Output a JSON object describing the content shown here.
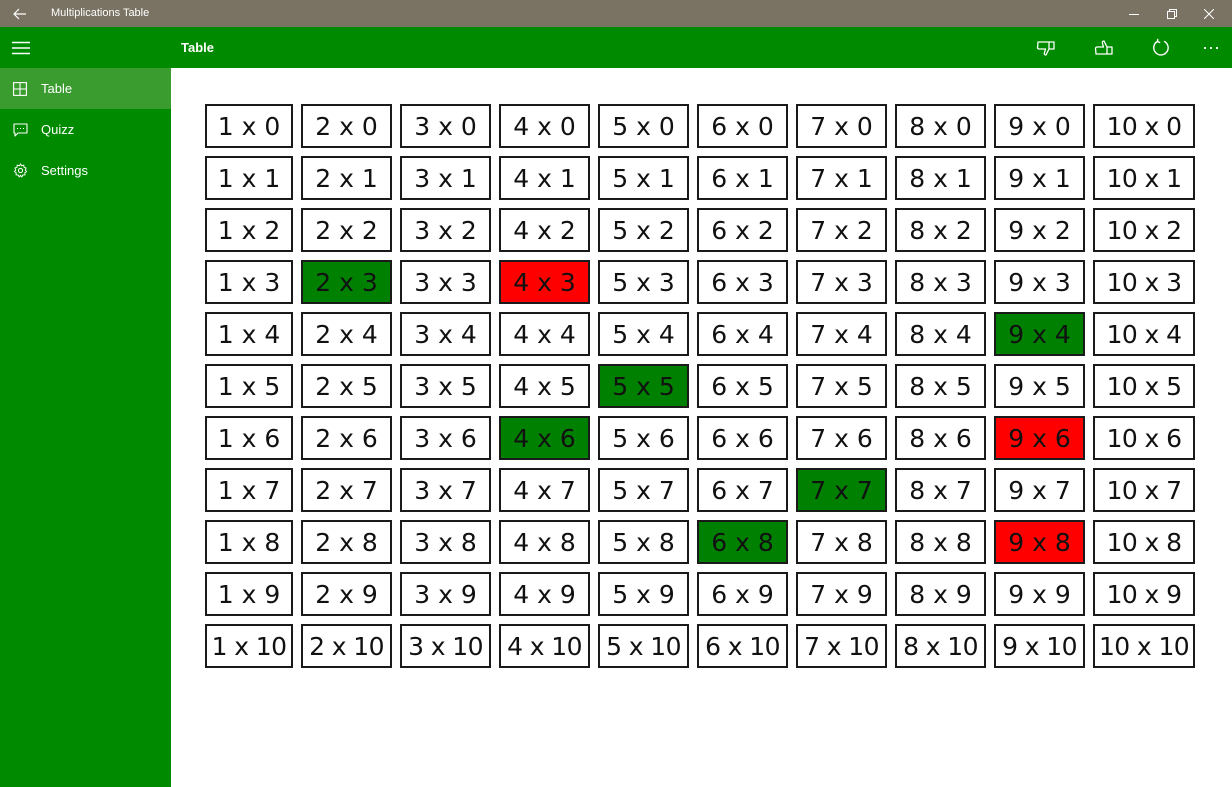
{
  "window": {
    "title": "Multiplications Table",
    "back_icon": "back-arrow-icon",
    "minimize_icon": "minimize-icon",
    "maximize_icon": "restore-icon",
    "close_icon": "close-icon"
  },
  "appbar": {
    "title": "Table",
    "menu_icon": "hamburger-icon",
    "actions": [
      "thumbs-down-icon",
      "thumbs-up-icon",
      "refresh-icon",
      "more-icon"
    ]
  },
  "sidebar": {
    "items": [
      {
        "label": "Table",
        "icon": "table-grid-icon",
        "selected": true
      },
      {
        "label": "Quizz",
        "icon": "chat-bubble-icon",
        "selected": false
      },
      {
        "label": "Settings",
        "icon": "gear-icon",
        "selected": false
      }
    ]
  },
  "colors": {
    "titlebar": "#7a7363",
    "accent": "#008a00",
    "selected_nav": "#3a9c2f",
    "correct": "#008000",
    "wrong": "#ff0000"
  },
  "table": {
    "rows": [
      [
        {
          "t": "1 x 0",
          "s": ""
        },
        {
          "t": "2 x 0",
          "s": ""
        },
        {
          "t": "3 x 0",
          "s": ""
        },
        {
          "t": "4 x 0",
          "s": ""
        },
        {
          "t": "5 x 0",
          "s": ""
        },
        {
          "t": "6 x 0",
          "s": ""
        },
        {
          "t": "7 x 0",
          "s": ""
        },
        {
          "t": "8 x 0",
          "s": ""
        },
        {
          "t": "9 x 0",
          "s": ""
        },
        {
          "t": "10 x 0",
          "s": ""
        }
      ],
      [
        {
          "t": "1 x 1",
          "s": ""
        },
        {
          "t": "2 x 1",
          "s": ""
        },
        {
          "t": "3 x 1",
          "s": ""
        },
        {
          "t": "4 x 1",
          "s": ""
        },
        {
          "t": "5 x 1",
          "s": ""
        },
        {
          "t": "6 x 1",
          "s": ""
        },
        {
          "t": "7 x 1",
          "s": ""
        },
        {
          "t": "8 x 1",
          "s": ""
        },
        {
          "t": "9 x 1",
          "s": ""
        },
        {
          "t": "10 x 1",
          "s": ""
        }
      ],
      [
        {
          "t": "1 x 2",
          "s": ""
        },
        {
          "t": "2 x 2",
          "s": ""
        },
        {
          "t": "3 x 2",
          "s": ""
        },
        {
          "t": "4 x 2",
          "s": ""
        },
        {
          "t": "5 x 2",
          "s": ""
        },
        {
          "t": "6 x 2",
          "s": ""
        },
        {
          "t": "7 x 2",
          "s": ""
        },
        {
          "t": "8 x 2",
          "s": ""
        },
        {
          "t": "9 x 2",
          "s": ""
        },
        {
          "t": "10 x 2",
          "s": ""
        }
      ],
      [
        {
          "t": "1 x 3",
          "s": ""
        },
        {
          "t": "2 x 3",
          "s": "green"
        },
        {
          "t": "3 x 3",
          "s": ""
        },
        {
          "t": "4 x 3",
          "s": "red"
        },
        {
          "t": "5 x 3",
          "s": ""
        },
        {
          "t": "6 x 3",
          "s": ""
        },
        {
          "t": "7 x 3",
          "s": ""
        },
        {
          "t": "8 x 3",
          "s": ""
        },
        {
          "t": "9 x 3",
          "s": ""
        },
        {
          "t": "10 x 3",
          "s": ""
        }
      ],
      [
        {
          "t": "1 x 4",
          "s": ""
        },
        {
          "t": "2 x 4",
          "s": ""
        },
        {
          "t": "3 x 4",
          "s": ""
        },
        {
          "t": "4 x 4",
          "s": ""
        },
        {
          "t": "5 x 4",
          "s": ""
        },
        {
          "t": "6 x 4",
          "s": ""
        },
        {
          "t": "7 x 4",
          "s": ""
        },
        {
          "t": "8 x 4",
          "s": ""
        },
        {
          "t": "9 x 4",
          "s": "green"
        },
        {
          "t": "10 x 4",
          "s": ""
        }
      ],
      [
        {
          "t": "1 x 5",
          "s": ""
        },
        {
          "t": "2 x 5",
          "s": ""
        },
        {
          "t": "3 x 5",
          "s": ""
        },
        {
          "t": "4 x 5",
          "s": ""
        },
        {
          "t": "5 x 5",
          "s": "green"
        },
        {
          "t": "6 x 5",
          "s": ""
        },
        {
          "t": "7 x 5",
          "s": ""
        },
        {
          "t": "8 x 5",
          "s": ""
        },
        {
          "t": "9 x 5",
          "s": ""
        },
        {
          "t": "10 x 5",
          "s": ""
        }
      ],
      [
        {
          "t": "1 x 6",
          "s": ""
        },
        {
          "t": "2 x 6",
          "s": ""
        },
        {
          "t": "3 x 6",
          "s": ""
        },
        {
          "t": "4 x 6",
          "s": "green"
        },
        {
          "t": "5 x 6",
          "s": ""
        },
        {
          "t": "6 x 6",
          "s": ""
        },
        {
          "t": "7 x 6",
          "s": ""
        },
        {
          "t": "8 x 6",
          "s": ""
        },
        {
          "t": "9 x 6",
          "s": "red"
        },
        {
          "t": "10 x 6",
          "s": ""
        }
      ],
      [
        {
          "t": "1 x 7",
          "s": ""
        },
        {
          "t": "2 x 7",
          "s": ""
        },
        {
          "t": "3 x 7",
          "s": ""
        },
        {
          "t": "4 x 7",
          "s": ""
        },
        {
          "t": "5 x 7",
          "s": ""
        },
        {
          "t": "6 x 7",
          "s": ""
        },
        {
          "t": "7 x 7",
          "s": "green"
        },
        {
          "t": "8 x 7",
          "s": ""
        },
        {
          "t": "9 x 7",
          "s": ""
        },
        {
          "t": "10 x 7",
          "s": ""
        }
      ],
      [
        {
          "t": "1 x 8",
          "s": ""
        },
        {
          "t": "2 x 8",
          "s": ""
        },
        {
          "t": "3 x 8",
          "s": ""
        },
        {
          "t": "4 x 8",
          "s": ""
        },
        {
          "t": "5 x 8",
          "s": ""
        },
        {
          "t": "6 x 8",
          "s": "green"
        },
        {
          "t": "7 x 8",
          "s": ""
        },
        {
          "t": "8 x 8",
          "s": ""
        },
        {
          "t": "9 x 8",
          "s": "red"
        },
        {
          "t": "10 x 8",
          "s": ""
        }
      ],
      [
        {
          "t": "1 x 9",
          "s": ""
        },
        {
          "t": "2 x 9",
          "s": ""
        },
        {
          "t": "3 x 9",
          "s": ""
        },
        {
          "t": "4 x 9",
          "s": ""
        },
        {
          "t": "5 x 9",
          "s": ""
        },
        {
          "t": "6 x 9",
          "s": ""
        },
        {
          "t": "7 x 9",
          "s": ""
        },
        {
          "t": "8 x 9",
          "s": ""
        },
        {
          "t": "9 x 9",
          "s": ""
        },
        {
          "t": "10 x 9",
          "s": ""
        }
      ],
      [
        {
          "t": "1 x 10",
          "s": ""
        },
        {
          "t": "2 x 10",
          "s": ""
        },
        {
          "t": "3 x 10",
          "s": ""
        },
        {
          "t": "4 x 10",
          "s": ""
        },
        {
          "t": "5 x 10",
          "s": ""
        },
        {
          "t": "6 x 10",
          "s": ""
        },
        {
          "t": "7 x 10",
          "s": ""
        },
        {
          "t": "8 x 10",
          "s": ""
        },
        {
          "t": "9 x 10",
          "s": ""
        },
        {
          "t": "10 x 10",
          "s": ""
        }
      ]
    ]
  }
}
